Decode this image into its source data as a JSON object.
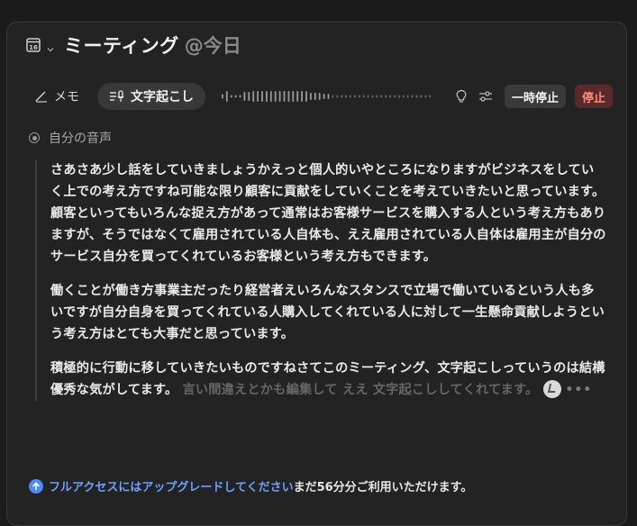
{
  "header": {
    "calendar_icon_day": "16",
    "title": "ミーティング",
    "subtitle": "@今日"
  },
  "toolbar": {
    "memo_label": "メモ",
    "transcribe_label": "文字起こし",
    "pause_label": "一時停止",
    "stop_label": "停止"
  },
  "source": {
    "label": "自分の音声"
  },
  "transcript": {
    "paragraphs": [
      "さあさあ少し話をしていきましょうかえっと個人的いやところになりますがビジネスをしていく上での考え方ですね可能な限り顧客に貢献をしていくことを考えていきたいと思っています。 顧客といってもいろんな捉え方があって通常はお客様サービスを購入する人という考え方もありますが、そうではなくて雇用されている人自体も、ええ雇用されている人自体は雇用主が自分のサービス自分を買ってくれているお客様という考え方もできます。",
      "働くことが働き方事業主だったり経営者えいろんなスタンスで立場で働いているという人も多いですが自分自身を買ってくれている人購入してくれている人に対して一生懸命貢献しようという考え方はとても大事だと思っています。",
      "積極的に行動に移していきたいものですねさてこのミーティング、文字起こしっていうのは結構優秀な気がしてます。"
    ],
    "pending_text": "言い間違えとかも編集して ええ 文字起こししてくれてます。",
    "typing_indicator": "•••"
  },
  "footer": {
    "upgrade_link": "フルアクセスにはアップグレードしてください",
    "remaining_text": "まだ56分分ご利用いただけます。"
  },
  "colors": {
    "accent": "#6ea0ff",
    "stop": "#ff8a7a",
    "background": "#232323"
  }
}
